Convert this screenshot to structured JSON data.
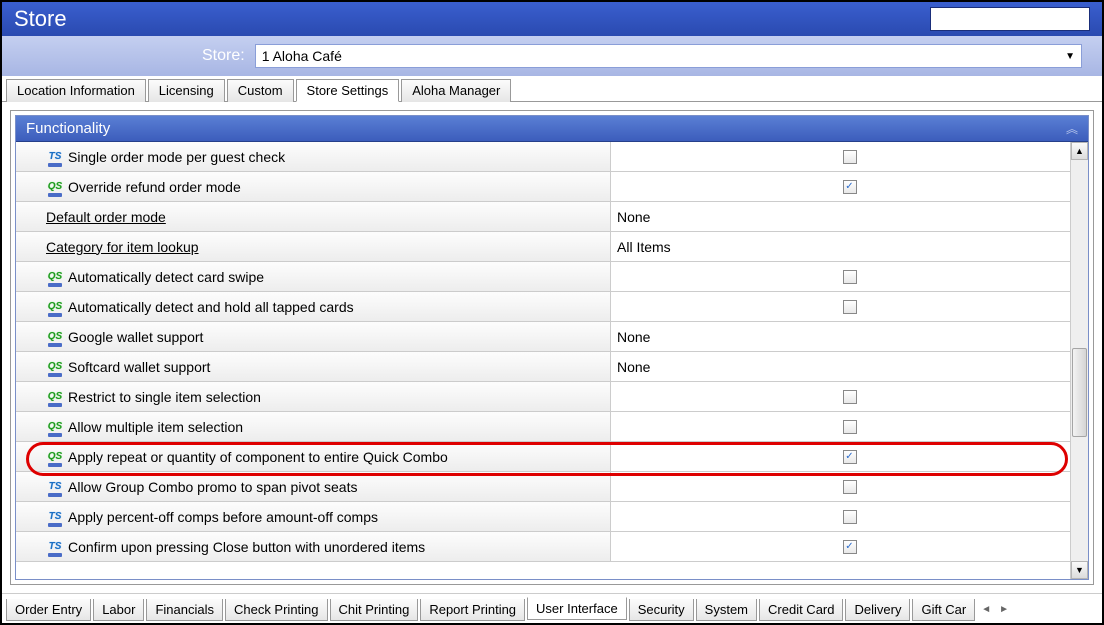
{
  "title": "Store",
  "storeLabel": "Store:",
  "storeValue": "1 Aloha Café",
  "topTabs": [
    {
      "label": "Location Information"
    },
    {
      "label": "Licensing"
    },
    {
      "label": "Custom"
    },
    {
      "label": "Store Settings",
      "active": true
    },
    {
      "label": "Aloha Manager"
    }
  ],
  "sectionTitle": "Functionality",
  "rows": [
    {
      "icon": "TS",
      "label": "Single order mode per guest check",
      "type": "check",
      "checked": false
    },
    {
      "icon": "QS",
      "label": "Override refund order mode",
      "type": "check",
      "checked": true
    },
    {
      "icon": "",
      "label": "Default order mode",
      "underline": true,
      "type": "select",
      "value": "None"
    },
    {
      "icon": "",
      "label": "Category for item lookup",
      "underline": true,
      "type": "select",
      "value": "All Items"
    },
    {
      "icon": "QS",
      "label": "Automatically detect card swipe",
      "type": "check",
      "checked": false
    },
    {
      "icon": "QS",
      "label": "Automatically detect and hold all tapped cards",
      "type": "check",
      "checked": false
    },
    {
      "icon": "QS",
      "label": "Google wallet support",
      "type": "select",
      "value": "None"
    },
    {
      "icon": "QS",
      "label": "Softcard wallet support",
      "type": "select",
      "value": "None"
    },
    {
      "icon": "QS",
      "label": "Restrict to single item selection",
      "type": "check",
      "checked": false
    },
    {
      "icon": "QS",
      "label": "Allow multiple item selection",
      "type": "check",
      "checked": false
    },
    {
      "icon": "QS",
      "label": "Apply repeat or quantity of component to entire Quick Combo",
      "type": "check",
      "checked": true,
      "highlight": true
    },
    {
      "icon": "TS",
      "label": "Allow Group Combo promo to span pivot seats",
      "type": "check",
      "checked": false
    },
    {
      "icon": "TS",
      "label": "Apply percent-off comps before amount-off comps",
      "type": "check",
      "checked": false
    },
    {
      "icon": "TS",
      "label": "Confirm upon pressing Close button with unordered items",
      "type": "check",
      "checked": true
    }
  ],
  "bottomTabs": [
    {
      "label": "Order Entry"
    },
    {
      "label": "Labor"
    },
    {
      "label": "Financials"
    },
    {
      "label": "Check Printing"
    },
    {
      "label": "Chit Printing"
    },
    {
      "label": "Report Printing"
    },
    {
      "label": "User Interface",
      "active": true
    },
    {
      "label": "Security"
    },
    {
      "label": "System"
    },
    {
      "label": "Credit Card"
    },
    {
      "label": "Delivery"
    },
    {
      "label": "Gift Car"
    }
  ]
}
